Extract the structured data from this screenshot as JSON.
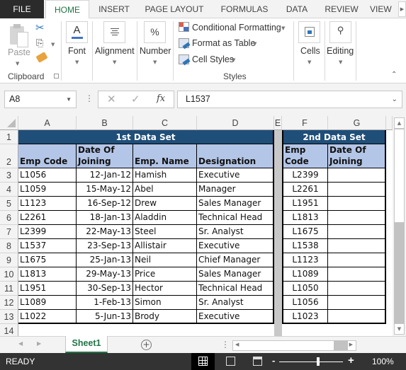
{
  "ribbon_tabs": [
    "FILE",
    "HOME",
    "INSERT",
    "PAGE LAYOUT",
    "FORMULAS",
    "DATA",
    "REVIEW",
    "VIEW"
  ],
  "active_tab": "HOME",
  "ribbon": {
    "clipboard": {
      "paste": "Paste",
      "label": "Clipboard"
    },
    "font": {
      "label": "Font"
    },
    "alignment": {
      "label": "Alignment"
    },
    "number": {
      "label": "Number",
      "icon_text": "%"
    },
    "styles": {
      "conditional": "Conditional Formatting",
      "format_table": "Format as Table",
      "cell_styles": "Cell Styles",
      "label": "Styles"
    },
    "cells": {
      "label": "Cells"
    },
    "editing": {
      "label": "Editing"
    }
  },
  "formula_bar": {
    "name_box": "A8",
    "formula": "L1537",
    "fx": "fx"
  },
  "columns": [
    "A",
    "B",
    "C",
    "D",
    "E",
    "F",
    "G"
  ],
  "rows": [
    "1",
    "2",
    "3",
    "4",
    "5",
    "6",
    "7",
    "8",
    "9",
    "10",
    "11",
    "12",
    "13",
    "14"
  ],
  "table1": {
    "title": "1st Data Set",
    "headers": [
      "Emp Code",
      "Date Of Joining",
      "Emp. Name",
      "Designation"
    ],
    "header_lines": [
      [
        "Emp Code"
      ],
      [
        "Date Of",
        "Joining"
      ],
      [
        "Emp. Name"
      ],
      [
        "Designation"
      ]
    ],
    "rows": [
      [
        "L1056",
        "12-Jan-12",
        "Hamish",
        "Executive"
      ],
      [
        "L1059",
        "15-May-12",
        "Abel",
        "Manager"
      ],
      [
        "L1123",
        "16-Sep-12",
        "Drew",
        "Sales Manager"
      ],
      [
        "L2261",
        "18-Jan-13",
        "Aladdin",
        "Technical Head"
      ],
      [
        "L2399",
        "22-May-13",
        "Steel",
        "Sr. Analyst"
      ],
      [
        "L1537",
        "23-Sep-13",
        "Allistair",
        "Executive"
      ],
      [
        "L1675",
        "25-Jan-13",
        "Neil",
        "Chief Manager"
      ],
      [
        "L1813",
        "29-May-13",
        "Price",
        "Sales Manager"
      ],
      [
        "L1951",
        "30-Sep-13",
        "Hector",
        "Technical Head"
      ],
      [
        "L1089",
        "1-Feb-13",
        "Simon",
        "Sr. Analyst"
      ],
      [
        "L1022",
        "5-Jun-13",
        "Brody",
        "Executive"
      ]
    ]
  },
  "table2": {
    "title": "2nd Data Set",
    "header_lines": [
      [
        "Emp",
        "Code"
      ],
      [
        "Date Of",
        "Joining"
      ]
    ],
    "rows": [
      [
        "L2399",
        ""
      ],
      [
        "L2261",
        ""
      ],
      [
        "L1951",
        ""
      ],
      [
        "L1813",
        ""
      ],
      [
        "L1675",
        ""
      ],
      [
        "L1538",
        ""
      ],
      [
        "L1123",
        ""
      ],
      [
        "L1089",
        ""
      ],
      [
        "L1050",
        ""
      ],
      [
        "L1056",
        ""
      ],
      [
        "L1023",
        ""
      ]
    ]
  },
  "sheets": [
    "Sheet1"
  ],
  "status": {
    "text": "READY",
    "zoom": "100%",
    "zoom_value_percent": 100
  },
  "colors": {
    "title_band": "#1f4e79",
    "header_fill": "#b4c6e7",
    "accent": "#217346",
    "status_bar": "#333333"
  }
}
